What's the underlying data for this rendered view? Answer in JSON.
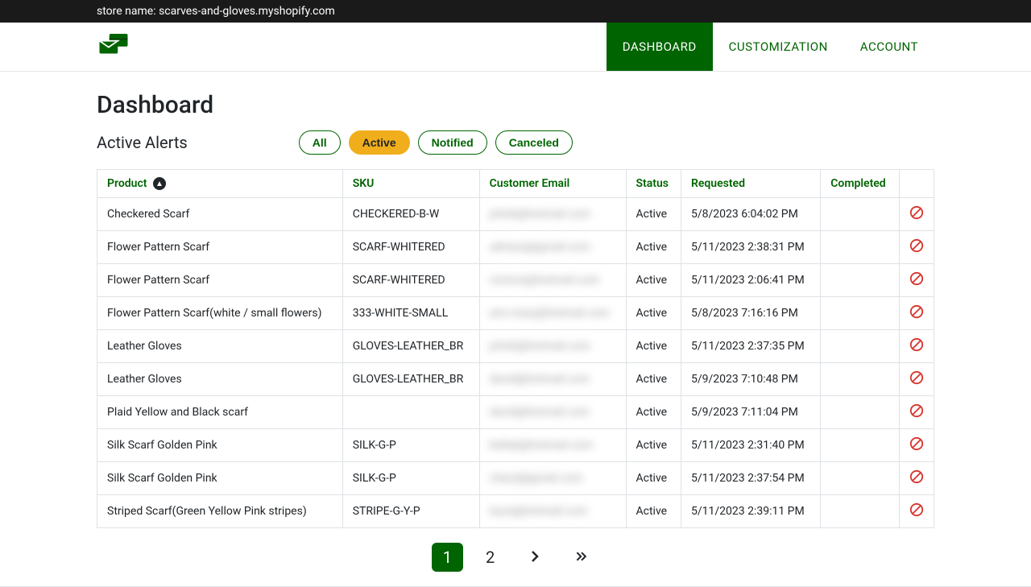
{
  "topbar": {
    "store_label": "store name: scarves-and-gloves.myshopify.com"
  },
  "nav": {
    "dashboard": "DASHBOARD",
    "customization": "CUSTOMIZATION",
    "account": "ACCOUNT"
  },
  "page": {
    "title": "Dashboard",
    "subtitle": "Active Alerts"
  },
  "filters": {
    "all": "All",
    "active": "Active",
    "notified": "Notified",
    "canceled": "Canceled"
  },
  "table": {
    "headers": {
      "product": "Product",
      "sku": "SKU",
      "email": "Customer Email",
      "status": "Status",
      "requested": "Requested",
      "completed": "Completed"
    },
    "rows": [
      {
        "product": "Checkered Scarf",
        "sku": "CHECKERED-B-W",
        "email": "johnb@hotmail.com",
        "status": "Active",
        "requested": "5/8/2023 6:04:02 PM",
        "completed": ""
      },
      {
        "product": "Flower Pattern Scarf",
        "sku": "SCARF-WHITERED",
        "email": "adriana@gmail.com",
        "status": "Active",
        "requested": "5/11/2023 2:38:31 PM",
        "completed": ""
      },
      {
        "product": "Flower Pattern Scarf",
        "sku": "SCARF-WHITERED",
        "email": "victoria@hotmail.com",
        "status": "Active",
        "requested": "5/11/2023 2:06:41 PM",
        "completed": ""
      },
      {
        "product": "Flower Pattern Scarf(white / small flowers)",
        "sku": "333-WHITE-SMALL",
        "email": "ann.mary@hotmail.com",
        "status": "Active",
        "requested": "5/8/2023 7:16:16 PM",
        "completed": ""
      },
      {
        "product": "Leather Gloves",
        "sku": "GLOVES-LEATHER_BR",
        "email": "johnb@hotmail.com",
        "status": "Active",
        "requested": "5/11/2023 2:37:35 PM",
        "completed": ""
      },
      {
        "product": "Leather Gloves",
        "sku": "GLOVES-LEATHER_BR",
        "email": "david@hotmail.com",
        "status": "Active",
        "requested": "5/9/2023 7:10:48 PM",
        "completed": ""
      },
      {
        "product": "Plaid Yellow and Black scarf",
        "sku": "",
        "email": "david@hotmail.com",
        "status": "Active",
        "requested": "5/9/2023 7:11:04 PM",
        "completed": ""
      },
      {
        "product": "Silk Scarf Golden Pink",
        "sku": "SILK-G-P",
        "email": "bellab@hotmail.com",
        "status": "Active",
        "requested": "5/11/2023 2:31:40 PM",
        "completed": ""
      },
      {
        "product": "Silk Scarf Golden Pink",
        "sku": "SILK-G-P",
        "email": "cheryl@gmail.com",
        "status": "Active",
        "requested": "5/11/2023 2:37:54 PM",
        "completed": ""
      },
      {
        "product": "Striped Scarf(Green Yellow Pink stripes)",
        "sku": "STRIPE-G-Y-P",
        "email": "laura@hotmail.com",
        "status": "Active",
        "requested": "5/11/2023 2:39:11 PM",
        "completed": ""
      }
    ]
  },
  "pagination": {
    "page1": "1",
    "page2": "2"
  }
}
